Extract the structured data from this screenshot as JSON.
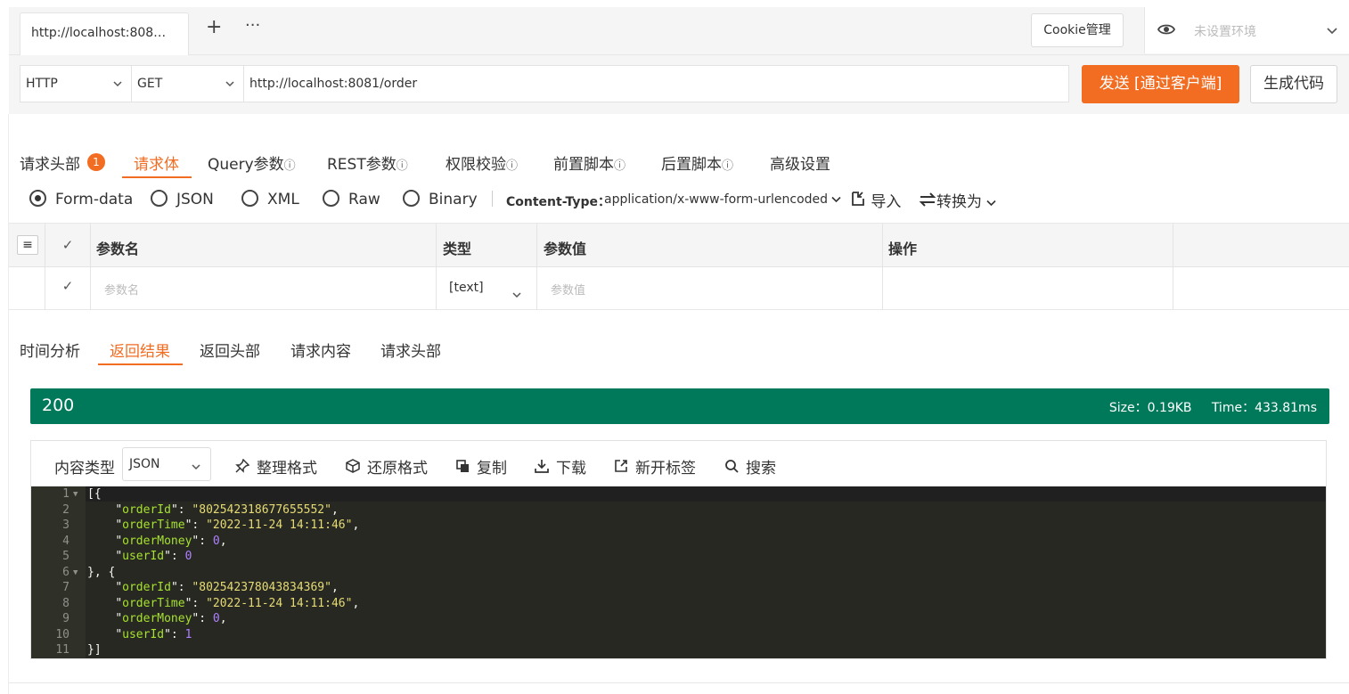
{
  "tabs": {
    "active_title": "http://localhost:808…",
    "add_icon": "plus-icon",
    "more_icon": "more-icon"
  },
  "header": {
    "cookie_label": "Cookie管理",
    "env_placeholder": "未设置环境",
    "eye_icon": "eye-icon"
  },
  "request": {
    "protocol": "HTTP",
    "method": "GET",
    "url": "http://localhost:8081/order",
    "send_label": "发送 [通过客户端]",
    "gen_code_label": "生成代码"
  },
  "req_tabs": [
    {
      "label": "请求头部",
      "badge": "1"
    },
    {
      "label": "请求体"
    },
    {
      "label": "Query参数"
    },
    {
      "label": "REST参数"
    },
    {
      "label": "权限校验"
    },
    {
      "label": "前置脚本"
    },
    {
      "label": "后置脚本"
    },
    {
      "label": "高级设置"
    }
  ],
  "body_types": [
    "Form-data",
    "JSON",
    "XML",
    "Raw",
    "Binary"
  ],
  "content_type": {
    "label": "Content-Type：",
    "value": "application/x-www-form-urlencoded"
  },
  "body_actions": {
    "import_label": "导入",
    "convert_label": "转换为"
  },
  "param_table": {
    "headers": [
      "参数名",
      "类型",
      "参数值",
      "操作"
    ],
    "row": {
      "name_placeholder": "参数名",
      "type": "[text]",
      "value_placeholder": "参数值"
    }
  },
  "resp_tabs": [
    "时间分析",
    "返回结果",
    "返回头部",
    "请求内容",
    "请求头部"
  ],
  "status": {
    "code": "200",
    "size": "Size：0.19KB",
    "time": "Time：433.81ms"
  },
  "toolbar": {
    "content_type_label": "内容类型",
    "format": "JSON",
    "beautify": "整理格式",
    "restore": "还原格式",
    "copy": "复制",
    "download": "下载",
    "new_tab": "新开标签",
    "search": "搜索"
  },
  "response_lines": [
    {
      "ln": "1",
      "text": "[{"
    },
    {
      "ln": "2",
      "key": "orderId",
      "value": "\"802542318677655552\"",
      "vtype": "s",
      "comma": true
    },
    {
      "ln": "3",
      "key": "orderTime",
      "value": "\"2022-11-24 14:11:46\"",
      "vtype": "s",
      "comma": true
    },
    {
      "ln": "4",
      "key": "orderMoney",
      "value": "0",
      "vtype": "n",
      "comma": true
    },
    {
      "ln": "5",
      "key": "userId",
      "value": "0",
      "vtype": "n",
      "comma": false
    },
    {
      "ln": "6",
      "text": "}, {"
    },
    {
      "ln": "7",
      "key": "orderId",
      "value": "\"802542378043834369\"",
      "vtype": "s",
      "comma": true
    },
    {
      "ln": "8",
      "key": "orderTime",
      "value": "\"2022-11-24 14:11:46\"",
      "vtype": "s",
      "comma": true
    },
    {
      "ln": "9",
      "key": "orderMoney",
      "value": "0",
      "vtype": "n",
      "comma": true
    },
    {
      "ln": "10",
      "key": "userId",
      "value": "1",
      "vtype": "n",
      "comma": false
    },
    {
      "ln": "11",
      "text": "}]"
    }
  ],
  "colors": {
    "accent": "#f26c22",
    "status_ok": "#00795b",
    "editor_bg": "#272822"
  }
}
